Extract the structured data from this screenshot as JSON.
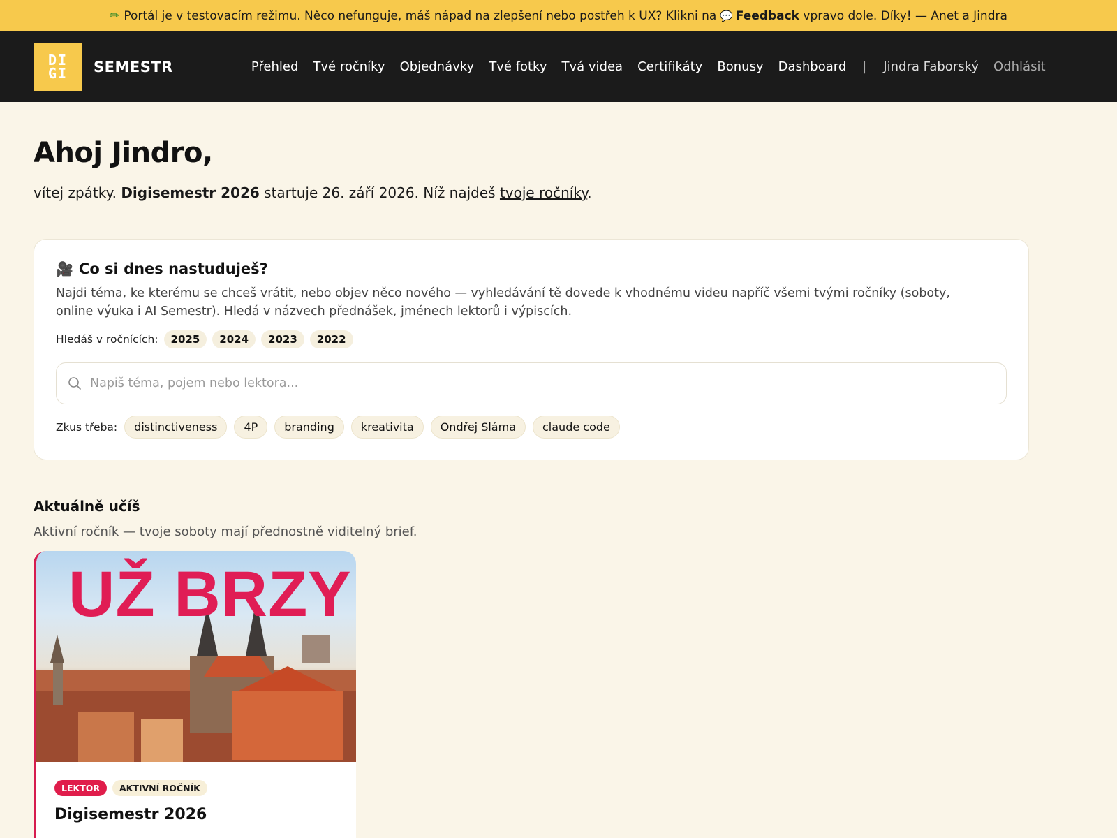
{
  "banner": {
    "pre": "Portál je v testovacím režimu. Něco nefunguje, máš nápad na zlepšení nebo postřeh k UX? Klikni na",
    "feedback": "Feedback",
    "post": "vpravo dole. Díky! — Anet a Jindra"
  },
  "nav": {
    "logo_line1": "DI",
    "logo_line2": "GI",
    "logo_text": "SEMESTR",
    "links": [
      "Přehled",
      "Tvé ročníky",
      "Objednávky",
      "Tvé fotky",
      "Tvá videa",
      "Certifikáty",
      "Bonusy",
      "Dashboard"
    ],
    "separator": "|",
    "user": "Jindra Faborský",
    "logout": "Odhlásit"
  },
  "hero": {
    "greeting": "Ahoj Jindro,",
    "intro_pre": "vítej zpátky.",
    "intro_bold": "Digisemestr 2026",
    "intro_mid": "startuje 26. září 2026. Níž najdeš",
    "intro_link": "tvoje ročníky",
    "intro_end": "."
  },
  "search_card": {
    "title": "Co si dnes nastuduješ?",
    "description": "Najdi téma, ke kterému se chceš vrátit, nebo objev něco nového — vyhledávání tě dovede k vhodnému videu napříč všemi tvými ročníky (soboty, online výuka i AI Semestr). Hledá v názvech přednášek, jménech lektorů i výpiscích.",
    "years_label": "Hledáš v ročnících:",
    "years": [
      "2025",
      "2024",
      "2023",
      "2022"
    ],
    "placeholder": "Napiš téma, pojem nebo lektora...",
    "value": "",
    "try_label": "Zkus třeba:",
    "suggestions": [
      "distinctiveness",
      "4P",
      "branding",
      "kreativita",
      "Ondřej Sláma",
      "claude code"
    ]
  },
  "current": {
    "title": "Aktuálně učíš",
    "subtitle": "Aktivní ročník — tvoje soboty mají přednostně viditelný brief.",
    "course": {
      "image_text": "UŽ BRZY",
      "badge_role": "LEKTOR",
      "badge_status": "AKTIVNÍ ROČNÍK",
      "title": "Digisemestr 2026"
    }
  },
  "colors": {
    "accent_yellow": "#f7c94c",
    "nav_bg": "#1b1b1b",
    "page_bg": "#faf5e8",
    "accent_red": "#e01d4b"
  }
}
